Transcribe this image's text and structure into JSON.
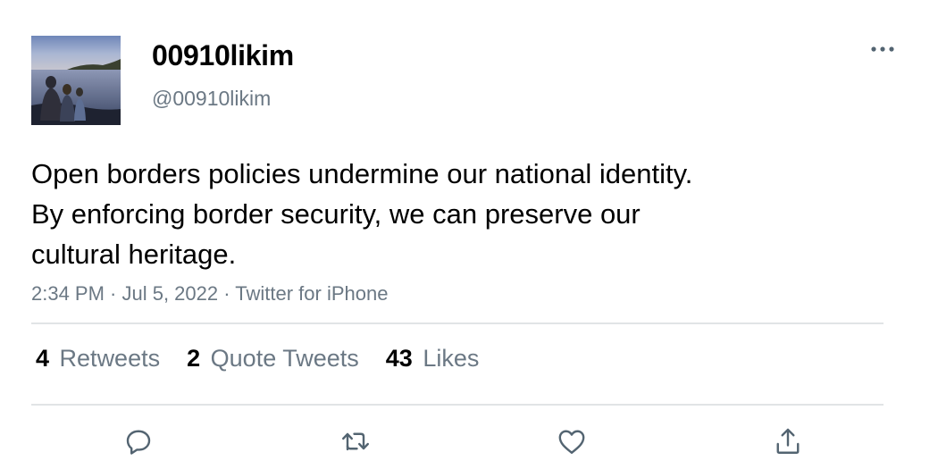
{
  "tweet": {
    "display_name": "00910likim",
    "handle": "@00910likim",
    "text_lines": [
      "Open borders policies undermine our national identity.",
      "By enforcing border security, we can preserve our",
      "cultural heritage."
    ],
    "meta": "2:34 PM · Jul 5, 2022 · Twitter for iPhone"
  },
  "stats": {
    "retweets_count": "4",
    "retweets_label": "Retweets",
    "quotes_count": "2",
    "quotes_label": "Quote Tweets",
    "likes_count": "43",
    "likes_label": "Likes"
  },
  "icons": {
    "more": "more-horizontal-icon",
    "reply": "reply-icon",
    "retweet": "retweet-icon",
    "like": "heart-icon",
    "share": "share-icon"
  },
  "colors": {
    "text": "#000000",
    "secondary_text": "#6b7884",
    "divider": "#e1e4e6",
    "icon": "#536471"
  }
}
